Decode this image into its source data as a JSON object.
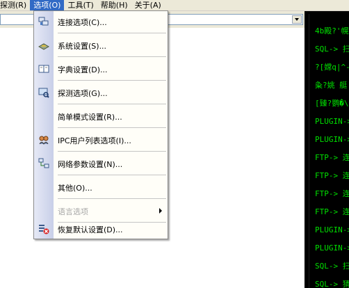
{
  "menubar": {
    "items": [
      {
        "label": "探测(R)"
      },
      {
        "label": "选项(O)"
      },
      {
        "label": "工具(T)"
      },
      {
        "label": "帮助(H)"
      },
      {
        "label": "关于(A)"
      }
    ]
  },
  "options_menu": {
    "items": [
      {
        "label": "连接选项(C)...",
        "icon": "network-connect-icon"
      },
      {
        "label": "系统设置(S)...",
        "icon": "system-settings-icon"
      },
      {
        "label": "字典设置(D)...",
        "icon": "dictionary-icon"
      },
      {
        "label": "探测选项(G)...",
        "icon": "probe-options-icon"
      },
      {
        "label": "简单模式设置(R)...",
        "icon": ""
      },
      {
        "label": "IPC用户列表选项(I)...",
        "icon": "ipc-users-icon"
      },
      {
        "label": "网络参数设置(N)...",
        "icon": "network-params-icon"
      },
      {
        "label": "其他(O)...",
        "icon": ""
      },
      {
        "label": "语言选项",
        "icon": "",
        "disabled": true,
        "submenu": true
      },
      {
        "label": "恢复默认设置(D)...",
        "icon": "restore-defaults-icon"
      }
    ]
  },
  "console": {
    "lines": [
      "4b殿?'幌",
      "SQL-> 扫描",
      "?[嫦q|^-塚",
      "粂?姚   艇",
      "[臻?鹦�\\",
      "PLUGIN-> 丰",
      "PLUGIN-> 丰",
      "FTP-> 连接",
      "FTP-> 连接",
      "FTP-> 连接",
      "FTP-> 连接",
      "PLUGIN-> 丰",
      "PLUGIN-> 丰",
      "SQL-> 扫描",
      "SQL-> 猜解"
    ],
    "text_color": "#00e000"
  },
  "colors": {
    "menubar_bg": "#ece9d8",
    "menubar_active": "#316ac5",
    "menu_bg": "#fffef8",
    "console_bg": "#000000"
  }
}
